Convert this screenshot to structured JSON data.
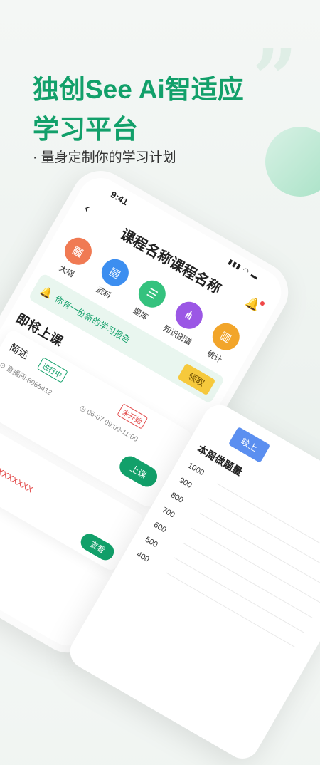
{
  "hero": {
    "line1": "独创See Ai智适应",
    "line2": "学习平台",
    "tagline": "· 量身定制你的学习计划"
  },
  "phone": {
    "time": "9:41",
    "title": "课程名称课程名称",
    "nav": [
      {
        "label": "大纲",
        "icon": "grid-icon",
        "color": "#f07a53"
      },
      {
        "label": "资料",
        "icon": "book-icon",
        "color": "#3c8ef0"
      },
      {
        "label": "题库",
        "icon": "list-icon",
        "color": "#35c27e"
      },
      {
        "label": "知识图谱",
        "icon": "graph-icon",
        "color": "#9b57e5"
      },
      {
        "label": "统计",
        "icon": "chart-icon",
        "color": "#f2a52a"
      }
    ],
    "notice": {
      "text": "你有一份新的学习报告",
      "button": "领取"
    },
    "section": "即将上课",
    "course": {
      "name": "简述",
      "status1": "进行中",
      "status2": "未开始",
      "room": "直播间-8965412",
      "time": "06-07 09:00-11:00",
      "button": "上课"
    },
    "course2": {
      "name": "命",
      "content": "XXXXXXXXXXXXXXXX",
      "button": "查看"
    }
  },
  "phone2": {
    "button": "较上",
    "title": "本周做题量",
    "ticks": [
      "1000",
      "900",
      "800",
      "700",
      "600",
      "500",
      "400"
    ]
  }
}
